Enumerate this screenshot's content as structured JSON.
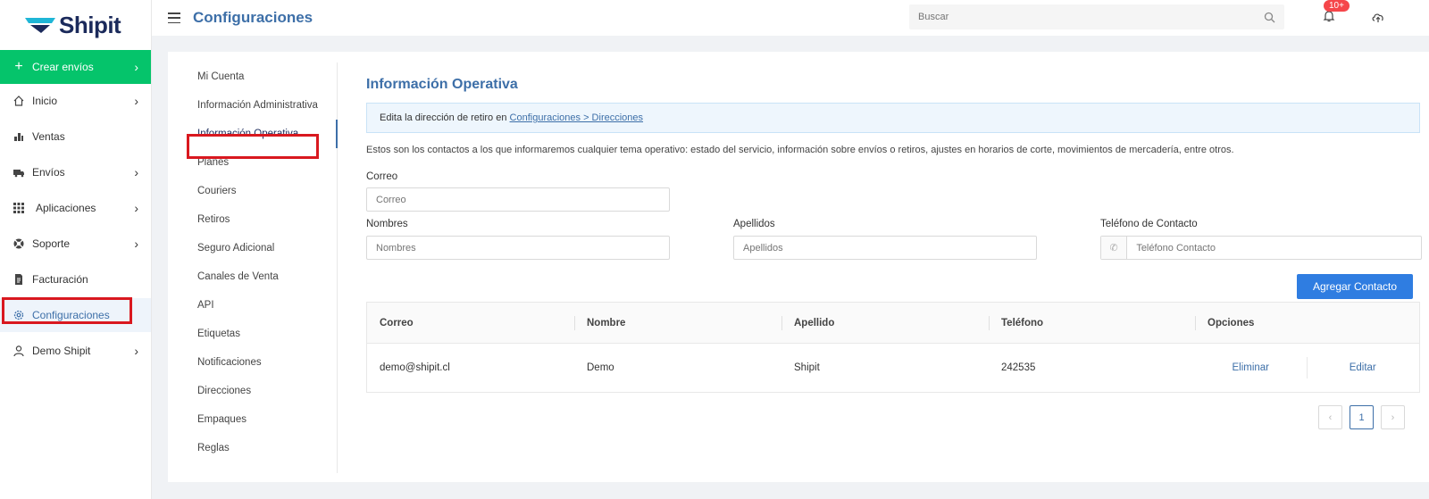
{
  "brand": {
    "name": "Shipit"
  },
  "sidebar": {
    "items": [
      {
        "label": "Crear envíos",
        "icon": "plus-icon"
      },
      {
        "label": "Inicio",
        "icon": "home-icon"
      },
      {
        "label": "Ventas",
        "icon": "sales-icon"
      },
      {
        "label": "Envíos",
        "icon": "truck-icon"
      },
      {
        "label": "Aplicaciones",
        "icon": "grid-icon"
      },
      {
        "label": "Soporte",
        "icon": "lifebuoy-icon"
      },
      {
        "label": "Facturación",
        "icon": "invoice-icon"
      },
      {
        "label": "Configuraciones",
        "icon": "gear-icon"
      },
      {
        "label": "Demo Shipit",
        "icon": "user-icon"
      }
    ]
  },
  "header": {
    "title": "Configuraciones",
    "search_placeholder": "Buscar",
    "notifications_badge": "10+"
  },
  "subnav": {
    "items": [
      "Mi Cuenta",
      "Información Administrativa",
      "Información Operativa",
      "Planes",
      "Couriers",
      "Retiros",
      "Seguro Adicional",
      "Canales de Venta",
      "API",
      "Etiquetas",
      "Notificaciones",
      "Direcciones",
      "Empaques",
      "Reglas"
    ],
    "active": "Información Operativa"
  },
  "content": {
    "title": "Información Operativa",
    "info_prefix": "Edita la dirección de retiro en ",
    "info_link": "Configuraciones > Direcciones",
    "description": "Estos son los contactos a los que informaremos cualquier tema operativo: estado del servicio, información sobre envíos o retiros, ajustes en horarios de corte, movimientos de mercadería, entre otros.",
    "form": {
      "email_label": "Correo",
      "email_placeholder": "Correo",
      "first_name_label": "Nombres",
      "first_name_placeholder": "Nombres",
      "last_name_label": "Apellidos",
      "last_name_placeholder": "Apellidos",
      "phone_label": "Teléfono de Contacto",
      "phone_placeholder": "Teléfono Contacto"
    },
    "add_button": "Agregar Contacto",
    "table": {
      "headers": [
        "Correo",
        "Nombre",
        "Apellido",
        "Teléfono",
        "Opciones"
      ],
      "rows": [
        {
          "email": "demo@shipit.cl",
          "name": "Demo",
          "last_name": "Shipit",
          "phone": "242535",
          "delete": "Eliminar",
          "edit": "Editar"
        }
      ]
    },
    "pagination": {
      "current": "1"
    }
  },
  "colors": {
    "accent": "#3d6fa8",
    "primary_green": "#05c46b",
    "button_blue": "#2f7de1",
    "highlight_red": "#d9181f"
  }
}
